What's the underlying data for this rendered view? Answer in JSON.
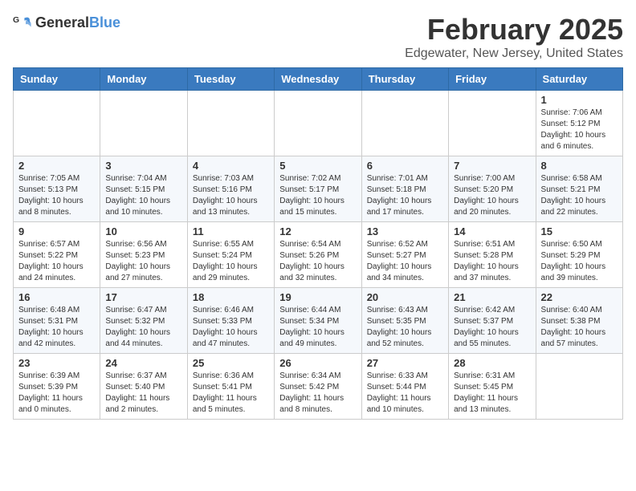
{
  "logo": {
    "general": "General",
    "blue": "Blue"
  },
  "title": "February 2025",
  "subtitle": "Edgewater, New Jersey, United States",
  "days_of_week": [
    "Sunday",
    "Monday",
    "Tuesday",
    "Wednesday",
    "Thursday",
    "Friday",
    "Saturday"
  ],
  "weeks": [
    [
      {
        "day": "",
        "info": ""
      },
      {
        "day": "",
        "info": ""
      },
      {
        "day": "",
        "info": ""
      },
      {
        "day": "",
        "info": ""
      },
      {
        "day": "",
        "info": ""
      },
      {
        "day": "",
        "info": ""
      },
      {
        "day": "1",
        "info": "Sunrise: 7:06 AM\nSunset: 5:12 PM\nDaylight: 10 hours and 6 minutes."
      }
    ],
    [
      {
        "day": "2",
        "info": "Sunrise: 7:05 AM\nSunset: 5:13 PM\nDaylight: 10 hours and 8 minutes."
      },
      {
        "day": "3",
        "info": "Sunrise: 7:04 AM\nSunset: 5:15 PM\nDaylight: 10 hours and 10 minutes."
      },
      {
        "day": "4",
        "info": "Sunrise: 7:03 AM\nSunset: 5:16 PM\nDaylight: 10 hours and 13 minutes."
      },
      {
        "day": "5",
        "info": "Sunrise: 7:02 AM\nSunset: 5:17 PM\nDaylight: 10 hours and 15 minutes."
      },
      {
        "day": "6",
        "info": "Sunrise: 7:01 AM\nSunset: 5:18 PM\nDaylight: 10 hours and 17 minutes."
      },
      {
        "day": "7",
        "info": "Sunrise: 7:00 AM\nSunset: 5:20 PM\nDaylight: 10 hours and 20 minutes."
      },
      {
        "day": "8",
        "info": "Sunrise: 6:58 AM\nSunset: 5:21 PM\nDaylight: 10 hours and 22 minutes."
      }
    ],
    [
      {
        "day": "9",
        "info": "Sunrise: 6:57 AM\nSunset: 5:22 PM\nDaylight: 10 hours and 24 minutes."
      },
      {
        "day": "10",
        "info": "Sunrise: 6:56 AM\nSunset: 5:23 PM\nDaylight: 10 hours and 27 minutes."
      },
      {
        "day": "11",
        "info": "Sunrise: 6:55 AM\nSunset: 5:24 PM\nDaylight: 10 hours and 29 minutes."
      },
      {
        "day": "12",
        "info": "Sunrise: 6:54 AM\nSunset: 5:26 PM\nDaylight: 10 hours and 32 minutes."
      },
      {
        "day": "13",
        "info": "Sunrise: 6:52 AM\nSunset: 5:27 PM\nDaylight: 10 hours and 34 minutes."
      },
      {
        "day": "14",
        "info": "Sunrise: 6:51 AM\nSunset: 5:28 PM\nDaylight: 10 hours and 37 minutes."
      },
      {
        "day": "15",
        "info": "Sunrise: 6:50 AM\nSunset: 5:29 PM\nDaylight: 10 hours and 39 minutes."
      }
    ],
    [
      {
        "day": "16",
        "info": "Sunrise: 6:48 AM\nSunset: 5:31 PM\nDaylight: 10 hours and 42 minutes."
      },
      {
        "day": "17",
        "info": "Sunrise: 6:47 AM\nSunset: 5:32 PM\nDaylight: 10 hours and 44 minutes."
      },
      {
        "day": "18",
        "info": "Sunrise: 6:46 AM\nSunset: 5:33 PM\nDaylight: 10 hours and 47 minutes."
      },
      {
        "day": "19",
        "info": "Sunrise: 6:44 AM\nSunset: 5:34 PM\nDaylight: 10 hours and 49 minutes."
      },
      {
        "day": "20",
        "info": "Sunrise: 6:43 AM\nSunset: 5:35 PM\nDaylight: 10 hours and 52 minutes."
      },
      {
        "day": "21",
        "info": "Sunrise: 6:42 AM\nSunset: 5:37 PM\nDaylight: 10 hours and 55 minutes."
      },
      {
        "day": "22",
        "info": "Sunrise: 6:40 AM\nSunset: 5:38 PM\nDaylight: 10 hours and 57 minutes."
      }
    ],
    [
      {
        "day": "23",
        "info": "Sunrise: 6:39 AM\nSunset: 5:39 PM\nDaylight: 11 hours and 0 minutes."
      },
      {
        "day": "24",
        "info": "Sunrise: 6:37 AM\nSunset: 5:40 PM\nDaylight: 11 hours and 2 minutes."
      },
      {
        "day": "25",
        "info": "Sunrise: 6:36 AM\nSunset: 5:41 PM\nDaylight: 11 hours and 5 minutes."
      },
      {
        "day": "26",
        "info": "Sunrise: 6:34 AM\nSunset: 5:42 PM\nDaylight: 11 hours and 8 minutes."
      },
      {
        "day": "27",
        "info": "Sunrise: 6:33 AM\nSunset: 5:44 PM\nDaylight: 11 hours and 10 minutes."
      },
      {
        "day": "28",
        "info": "Sunrise: 6:31 AM\nSunset: 5:45 PM\nDaylight: 11 hours and 13 minutes."
      },
      {
        "day": "",
        "info": ""
      }
    ]
  ]
}
